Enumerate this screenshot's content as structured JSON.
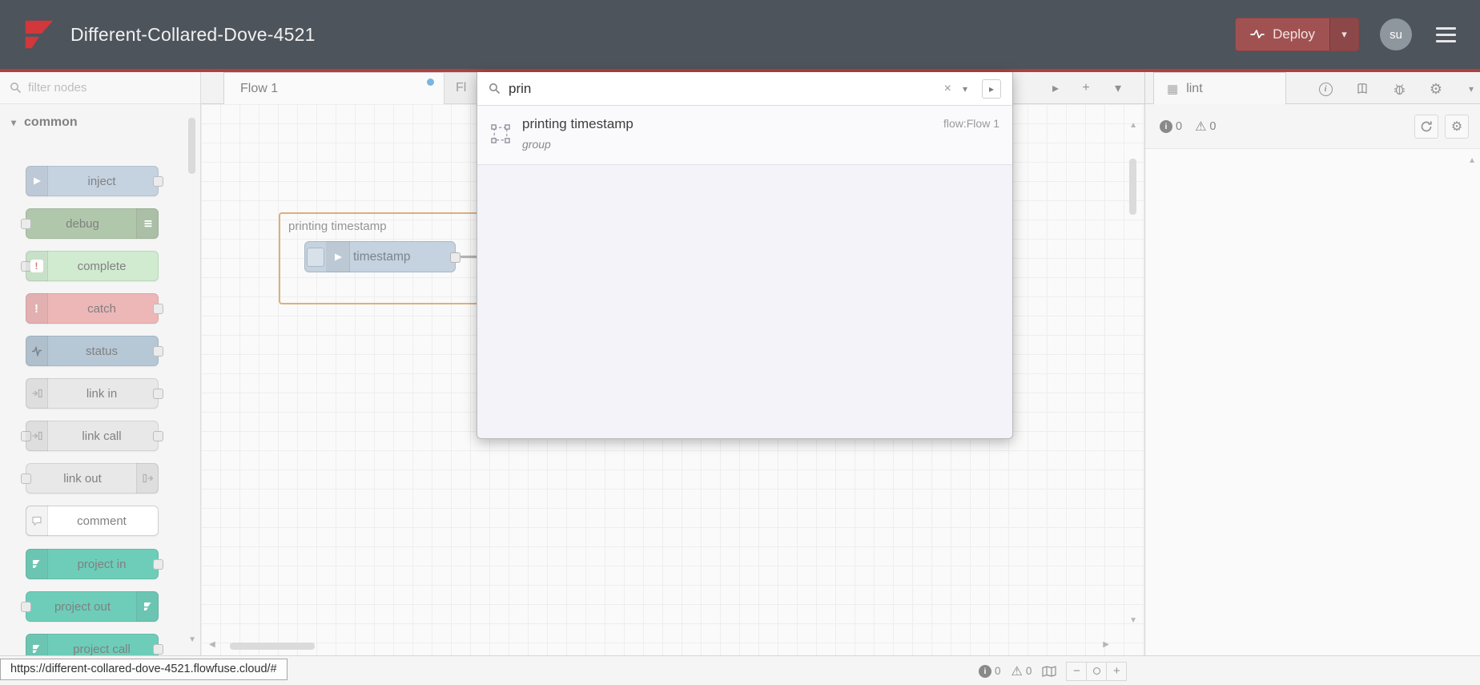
{
  "header": {
    "title": "Different-Collared-Dove-4521",
    "deploy": "Deploy",
    "avatar": "su"
  },
  "palette": {
    "filter_placeholder": "filter nodes",
    "category": "common",
    "nodes": [
      {
        "label": "inject",
        "color": "#a6bbcf",
        "border": "#8aa0b5"
      },
      {
        "label": "debug",
        "color": "#87a980",
        "border": "#6f9266"
      },
      {
        "label": "complete",
        "color": "#b8e0b8",
        "border": "#95c295"
      },
      {
        "label": "catch",
        "color": "#e49191",
        "border": "#cc7777"
      },
      {
        "label": "status",
        "color": "#8fa9bf",
        "border": "#7391ab"
      },
      {
        "label": "link in",
        "color": "#dcdcdc",
        "border": "#bbbbbb"
      },
      {
        "label": "link call",
        "color": "#dcdcdc",
        "border": "#bbbbbb"
      },
      {
        "label": "link out",
        "color": "#dcdcdc",
        "border": "#bbbbbb"
      },
      {
        "label": "comment",
        "color": "#ffffff",
        "border": "#b8b8b8"
      },
      {
        "label": "project in",
        "color": "#1fb394",
        "border": "#16987d"
      },
      {
        "label": "project out",
        "color": "#1fb394",
        "border": "#16987d"
      },
      {
        "label": "project call",
        "color": "#1fb394",
        "border": "#16987d"
      }
    ]
  },
  "tabs": {
    "flow1": "Flow 1",
    "partial": "Fl"
  },
  "canvas": {
    "group_label": "printing timestamp",
    "node_label": "timestamp"
  },
  "search": {
    "query": "prin",
    "result_title": "printing timestamp",
    "result_type": "group",
    "result_flow": "flow:Flow 1"
  },
  "sidebar": {
    "tab": "lint",
    "info_count": "0",
    "warning_count": "0"
  },
  "footer": {
    "info_count": "0",
    "warning_count": "0"
  },
  "statusbar": {
    "url": "https://different-collared-dove-4521.flowfuse.cloud/#"
  },
  "colors": {
    "deploy_red": "#a05252",
    "header_accent_line": "#b04040",
    "tab_modified_dot": "#2f8fd0"
  },
  "icons": {
    "plus": "+",
    "minus": "−",
    "close": "×",
    "caret_down": "▾",
    "caret_right": "▸",
    "gear": "⚙",
    "warning": "⚠",
    "grid": "▦",
    "info_letter": "i",
    "exclamation": "!",
    "tri_up": "▲",
    "tri_down": "▼",
    "tri_left": "◀",
    "tri_right": "▶"
  }
}
